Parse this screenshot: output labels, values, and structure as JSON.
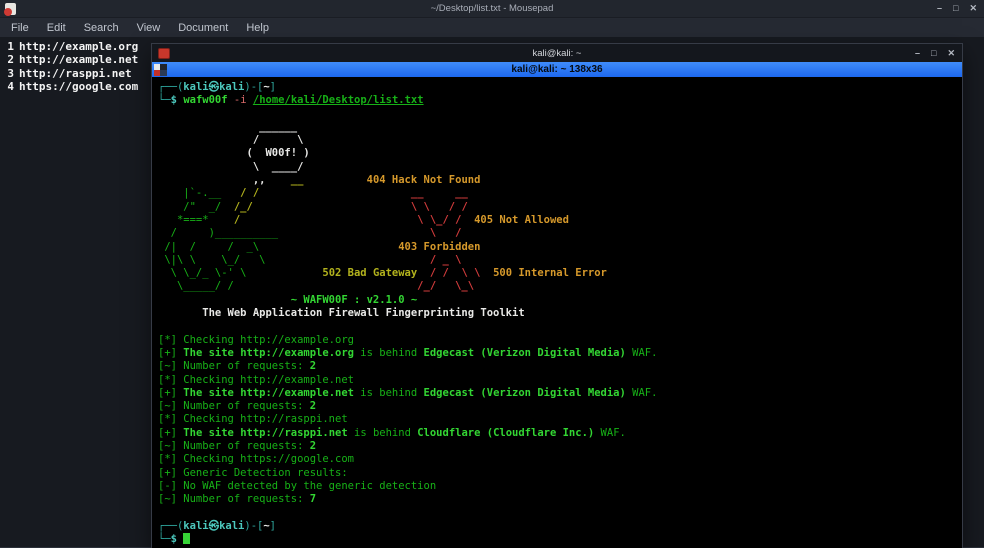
{
  "palette": {
    "term_bg": "#000000",
    "tab_blue": "#1d68ef",
    "tab_blue_light": "#3f8cfa",
    "white": "#e9e9e7",
    "green": "#17b117",
    "bright_green": "#33d633",
    "yellow": "#b3b31d",
    "orange": "#d6992b",
    "red": "#d23c3c",
    "teal": "#2fa9a0",
    "bright_teal": "#4cc8bd",
    "salmon": "#d96a6a",
    "cursor_green": "#37d437"
  },
  "mousepad": {
    "title": "~/Desktop/list.txt - Mousepad",
    "menu": [
      "File",
      "Edit",
      "Search",
      "View",
      "Document",
      "Help"
    ],
    "controls": [
      "–",
      "□",
      "✕"
    ],
    "lines": [
      {
        "num": "1",
        "text": "http://example.org"
      },
      {
        "num": "2",
        "text": "http://example.net"
      },
      {
        "num": "3",
        "text": "http://rasppi.net"
      },
      {
        "num": "4",
        "text": "https://google.com"
      }
    ]
  },
  "terminal": {
    "title": "kali@kali: ~",
    "tab_title": "kali@kali: ~ 138x36",
    "controls": [
      "–",
      "□",
      "✕"
    ],
    "lines": [
      {
        "s": [
          [
            "t",
            "┌──("
          ],
          [
            "bt",
            "kali㉿kali"
          ],
          [
            "t",
            ")-["
          ],
          [
            "w",
            "~"
          ],
          [
            "t",
            "]"
          ]
        ]
      },
      {
        "s": [
          [
            "t",
            "└─"
          ],
          [
            "bt",
            "$"
          ],
          [
            "w",
            " "
          ],
          [
            "bg",
            "wafw00f"
          ],
          [
            "w",
            " "
          ],
          [
            "rd",
            "-i"
          ],
          [
            "w",
            " "
          ],
          [
            "gu",
            "/home/kali/Desktop/list.txt"
          ]
        ]
      },
      {
        "s": []
      },
      {
        "s": [
          [
            "w",
            "                ______"
          ]
        ]
      },
      {
        "s": [
          [
            "w",
            "               /      \\"
          ]
        ]
      },
      {
        "s": [
          [
            "w",
            "              (  W00f! )"
          ]
        ]
      },
      {
        "s": [
          [
            "w",
            "               \\  ____/"
          ]
        ]
      },
      {
        "s": [
          [
            "w",
            "               ,,"
          ],
          [
            "y",
            "    __"
          ],
          [
            "o",
            "          404 Hack Not Found"
          ]
        ]
      },
      {
        "s": [
          [
            "g",
            "    |`-.__"
          ],
          [
            "y",
            "   / /"
          ],
          [
            "r",
            "                        __     __"
          ]
        ]
      },
      {
        "s": [
          [
            "g",
            "    /\"  _/"
          ],
          [
            "y",
            "  /_/"
          ],
          [
            "r",
            "                         \\ \\   / /"
          ]
        ]
      },
      {
        "s": [
          [
            "g",
            "   *===*"
          ],
          [
            "y",
            "    /"
          ],
          [
            "r",
            "                            \\ \\_/ /"
          ],
          [
            "o",
            "  405 Not Allowed"
          ]
        ]
      },
      {
        "s": [
          [
            "g",
            "  /     )__________"
          ],
          [
            "r",
            "                        \\   /"
          ]
        ]
      },
      {
        "s": [
          [
            "g",
            " /|  /     /  _\\"
          ],
          [
            "o",
            "                      403 Forbidden"
          ]
        ]
      },
      {
        "s": [
          [
            "g",
            " \\|\\ \\    \\_/   \\"
          ],
          [
            "r",
            "                          / _ \\"
          ]
        ]
      },
      {
        "s": [
          [
            "g",
            "  \\ \\_/_ \\-' \\"
          ],
          [
            "y",
            "            502 Bad Gateway"
          ],
          [
            "r",
            "  / /  \\ \\"
          ],
          [
            "o",
            "  500 Internal Error"
          ]
        ]
      },
      {
        "s": [
          [
            "g",
            "   \\_____/ /"
          ],
          [
            "r",
            "                             /_/   \\_\\"
          ]
        ]
      },
      {
        "s": [
          [
            "bg",
            "                     ~ WAFW00F : v2.1.0 ~"
          ]
        ]
      },
      {
        "s": [
          [
            "w",
            "       The Web Application Firewall Fingerprinting Toolkit"
          ]
        ]
      },
      {
        "s": []
      },
      {
        "s": [
          [
            "g",
            "[*] Checking http://example.org"
          ]
        ]
      },
      {
        "s": [
          [
            "g",
            "[+] "
          ],
          [
            "bg",
            "The site http://example.org"
          ],
          [
            "g",
            " is behind "
          ],
          [
            "bg",
            "Edgecast (Verizon Digital Media)"
          ],
          [
            "g",
            " WAF."
          ]
        ]
      },
      {
        "s": [
          [
            "g",
            "[~] Number of requests: "
          ],
          [
            "bg",
            "2"
          ]
        ]
      },
      {
        "s": [
          [
            "g",
            "[*] Checking http://example.net"
          ]
        ]
      },
      {
        "s": [
          [
            "g",
            "[+] "
          ],
          [
            "bg",
            "The site http://example.net"
          ],
          [
            "g",
            " is behind "
          ],
          [
            "bg",
            "Edgecast (Verizon Digital Media)"
          ],
          [
            "g",
            " WAF."
          ]
        ]
      },
      {
        "s": [
          [
            "g",
            "[~] Number of requests: "
          ],
          [
            "bg",
            "2"
          ]
        ]
      },
      {
        "s": [
          [
            "g",
            "[*] Checking http://rasppi.net"
          ]
        ]
      },
      {
        "s": [
          [
            "g",
            "[+] "
          ],
          [
            "bg",
            "The site http://rasppi.net"
          ],
          [
            "g",
            " is behind "
          ],
          [
            "bg",
            "Cloudflare (Cloudflare Inc.)"
          ],
          [
            "g",
            " WAF."
          ]
        ]
      },
      {
        "s": [
          [
            "g",
            "[~] Number of requests: "
          ],
          [
            "bg",
            "2"
          ]
        ]
      },
      {
        "s": [
          [
            "g",
            "[*] Checking https://google.com"
          ]
        ]
      },
      {
        "s": [
          [
            "g",
            "[+] Generic Detection results:"
          ]
        ]
      },
      {
        "s": [
          [
            "g",
            "[-] No WAF detected by the generic detection"
          ]
        ]
      },
      {
        "s": [
          [
            "g",
            "[~] Number of requests: "
          ],
          [
            "bg",
            "7"
          ]
        ]
      },
      {
        "s": []
      },
      {
        "s": [
          [
            "t",
            "┌──("
          ],
          [
            "bt",
            "kali㉿kali"
          ],
          [
            "t",
            ")-["
          ],
          [
            "w",
            "~"
          ],
          [
            "t",
            "]"
          ]
        ]
      },
      {
        "s": [
          [
            "t",
            "└─"
          ],
          [
            "bt",
            "$"
          ],
          [
            "w",
            " "
          ]
        ],
        "cursor": true
      }
    ]
  }
}
